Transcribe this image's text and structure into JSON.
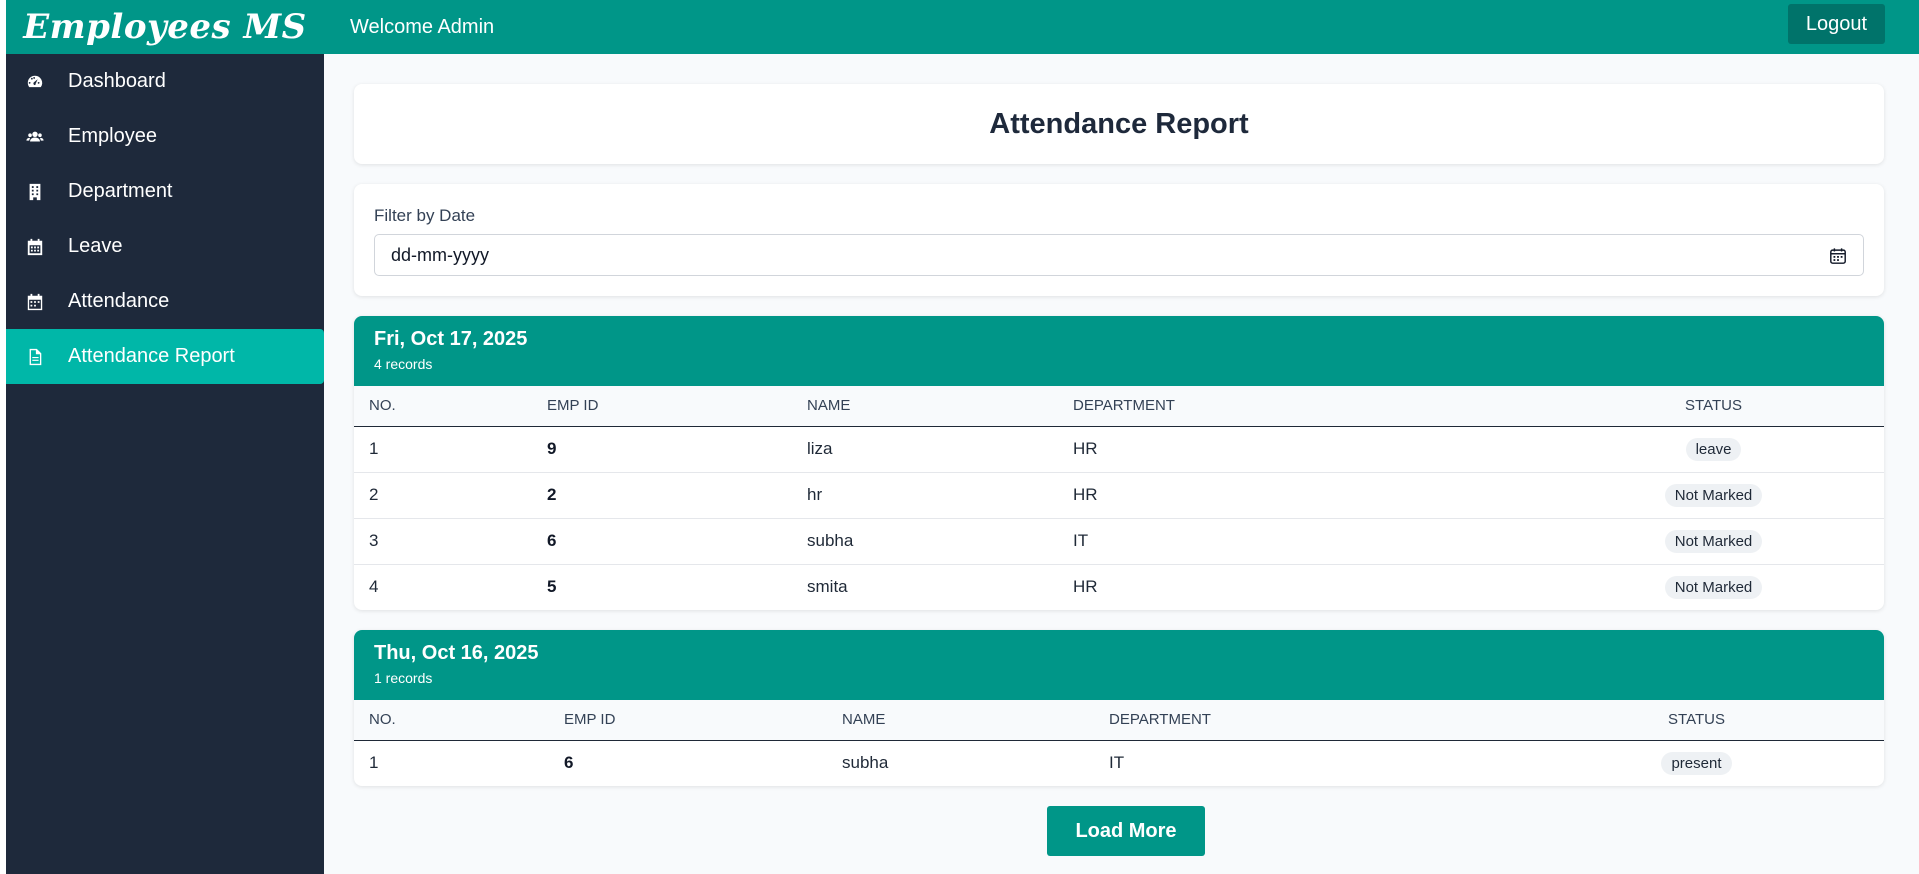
{
  "app": {
    "brand": "Employees MS",
    "welcome": "Welcome Admin",
    "logout_label": "Logout"
  },
  "sidebar": {
    "items": [
      {
        "label": "Dashboard",
        "icon": "dashboard-gauge-icon"
      },
      {
        "label": "Employee",
        "icon": "users-icon"
      },
      {
        "label": "Department",
        "icon": "building-icon"
      },
      {
        "label": "Leave",
        "icon": "calendar-grid-icon"
      },
      {
        "label": "Attendance",
        "icon": "calendar-icon"
      },
      {
        "label": "Attendance Report",
        "icon": "document-icon",
        "active": true
      }
    ]
  },
  "page": {
    "title": "Attendance Report",
    "filter": {
      "label": "Filter by Date",
      "placeholder": "dd-mm-yyyy"
    },
    "columns": {
      "no": "NO.",
      "emp_id": "EMP ID",
      "name": "NAME",
      "department": "DEPARTMENT",
      "status": "STATUS"
    },
    "groups": [
      {
        "date": "Fri, Oct 17, 2025",
        "count_text": "4 records",
        "rows": [
          {
            "no": "1",
            "emp_id": "9",
            "name": "liza",
            "department": "HR",
            "status": "leave"
          },
          {
            "no": "2",
            "emp_id": "2",
            "name": "hr",
            "department": "HR",
            "status": "Not Marked"
          },
          {
            "no": "3",
            "emp_id": "6",
            "name": "subha",
            "department": "IT",
            "status": "Not Marked"
          },
          {
            "no": "4",
            "emp_id": "5",
            "name": "smita",
            "department": "HR",
            "status": "Not Marked"
          }
        ]
      },
      {
        "date": "Thu, Oct 16, 2025",
        "count_text": "1 records",
        "rows": [
          {
            "no": "1",
            "emp_id": "6",
            "name": "subha",
            "department": "IT",
            "status": "present"
          }
        ]
      }
    ],
    "load_more_label": "Load More"
  },
  "colors": {
    "primary": "#009688",
    "primary_dark": "#00736a",
    "sidebar_bg": "#1e293b",
    "active_item": "#00b7a8",
    "page_bg": "#f8fafc"
  }
}
